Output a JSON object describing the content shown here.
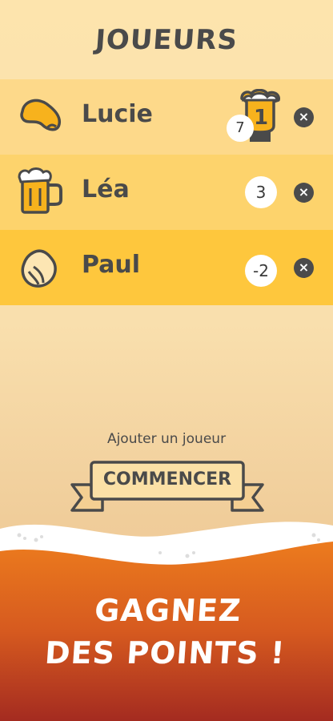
{
  "title": "JOUEURS",
  "players": [
    {
      "name": "Lucie",
      "score": "7",
      "rank": "1",
      "icon": "potato-chip-icon",
      "bg": "#fdd98a"
    },
    {
      "name": "Léa",
      "score": "3",
      "icon": "beer-mug-icon",
      "bg": "#fdd36c"
    },
    {
      "name": "Paul",
      "score": "-2",
      "icon": "pistachio-icon",
      "bg": "#fec73d"
    }
  ],
  "add_player": "Ajouter un joueur",
  "start_button": "COMMENCER",
  "promo": [
    "GAGNEZ",
    "DES POINTS !"
  ],
  "delete_symbol": "×",
  "colors": {
    "accent": "#f7b21d",
    "dark": "#4a4a4a",
    "orange": "#e5701c",
    "red": "#a42b20"
  }
}
